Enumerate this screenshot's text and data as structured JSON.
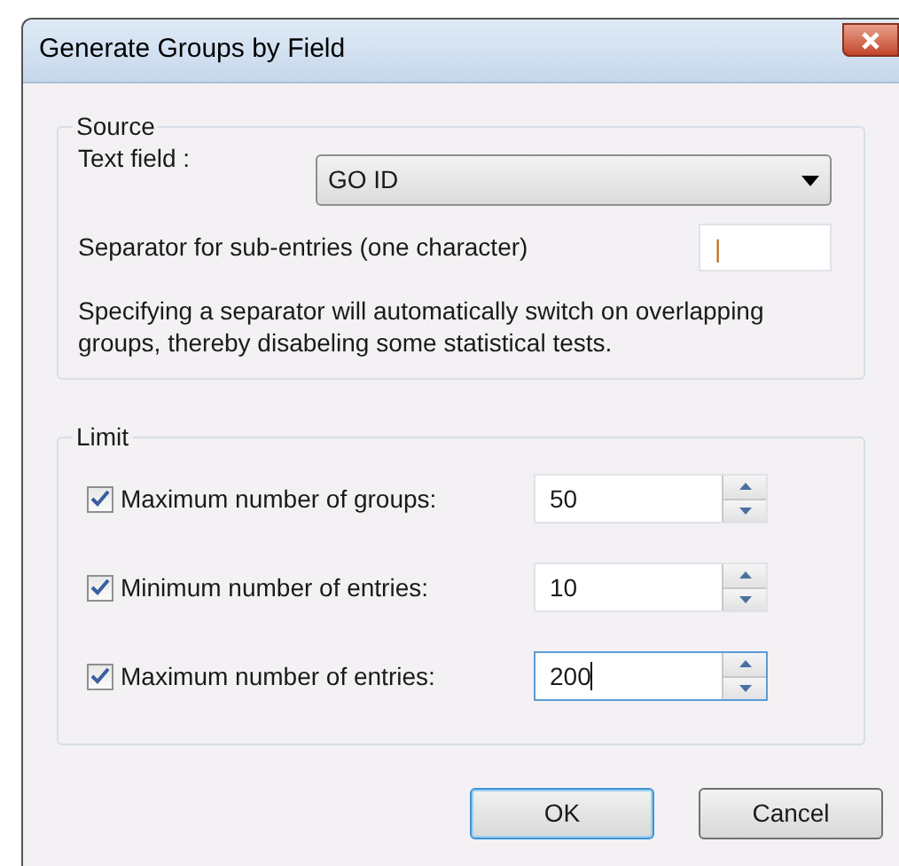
{
  "window": {
    "title": "Generate Groups by Field"
  },
  "source": {
    "label": "Source",
    "text_field": {
      "label": "Text field :",
      "value": "GO ID"
    },
    "separator": {
      "label": "Separator for sub-entries (one character)",
      "value": "|"
    },
    "note": "Specifying a separator will automatically switch on overlapping groups, thereby disabeling some statistical tests."
  },
  "limit": {
    "label": "Limit",
    "rows": [
      {
        "label": "Maximum number of groups:",
        "checked": true,
        "value": "50",
        "focused": false
      },
      {
        "label": "Minimum number of entries:",
        "checked": true,
        "value": "10",
        "focused": false
      },
      {
        "label": "Maximum number of entries:",
        "checked": true,
        "value": "200",
        "focused": true
      }
    ]
  },
  "buttons": [
    {
      "label": "OK",
      "default": true
    },
    {
      "label": "Cancel",
      "default": false
    }
  ]
}
